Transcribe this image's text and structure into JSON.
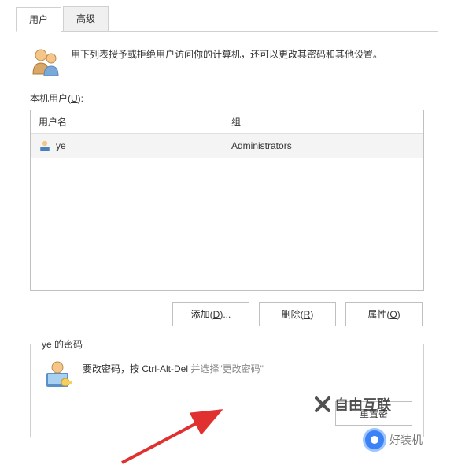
{
  "tabs": {
    "users": "用户",
    "advanced": "高级"
  },
  "info": {
    "text": "用下列表授予或拒绝用户访问你的计算机，还可以更改其密码和其他设置。"
  },
  "section": {
    "label_prefix": "本机用户(",
    "label_key": "U",
    "label_suffix": "):"
  },
  "table": {
    "headers": {
      "username": "用户名",
      "group": "组"
    },
    "rows": [
      {
        "username": "ye",
        "group": "Administrators"
      }
    ]
  },
  "buttons": {
    "add_prefix": "添加(",
    "add_key": "D",
    "add_suffix": ")...",
    "remove_prefix": "删除(",
    "remove_key": "R",
    "remove_suffix": ")",
    "properties_prefix": "属性(",
    "properties_key": "O",
    "properties_suffix": ")",
    "reset_prefix": "重置密",
    "reset_suffix": ""
  },
  "password_group": {
    "title": "ye 的密码",
    "text_part1": "要改密码，按 Ctrl-Alt-Del ",
    "text_part2": "并选择\"更改密码\""
  },
  "watermarks": {
    "w1": "自由互联",
    "w2": "好装机"
  }
}
